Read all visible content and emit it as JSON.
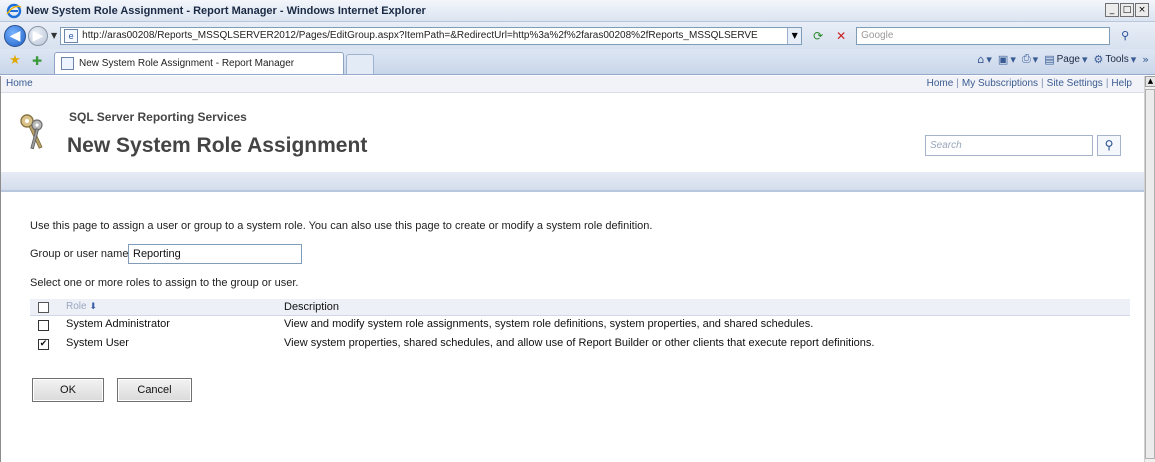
{
  "window": {
    "title": "New System Role Assignment - Report Manager - Windows Internet Explorer",
    "controls": {
      "minimize": "_",
      "maximize": "□",
      "close": "×"
    }
  },
  "addressbar": {
    "url": "http://aras00208/Reports_MSSQLSERVER2012/Pages/EditGroup.aspx?ItemPath=&RedirectUrl=http%3a%2f%2faras00208%2fReports_MSSQLSERVE",
    "search_placeholder": "Google"
  },
  "tabbar": {
    "tab_title": "New System Role Assignment - Report Manager",
    "commands": {
      "page": "Page",
      "tools": "Tools"
    }
  },
  "report_manager": {
    "breadcrumb_home": "Home",
    "top_links": [
      "Home",
      "My Subscriptions",
      "Site Settings",
      "Help"
    ],
    "product_name": "SQL Server Reporting Services",
    "page_title": "New System Role Assignment",
    "search_placeholder": "Search"
  },
  "form": {
    "intro": "Use this page to assign a user or group to a system role. You can also use this page to create or modify a system role definition.",
    "group_label": "Group or user name:",
    "group_value": "Reporting",
    "select_prompt": "Select one or more roles to assign to the group or user.",
    "table": {
      "col_role": "Role",
      "col_description": "Description",
      "rows": [
        {
          "role": "System Administrator",
          "description": "View and modify system role assignments, system role definitions, system properties, and shared schedules.",
          "checked": false
        },
        {
          "role": "System User",
          "description": "View system properties, shared schedules, and allow use of Report Builder or other clients that execute report definitions.",
          "checked": true
        }
      ]
    },
    "ok_label": "OK",
    "cancel_label": "Cancel"
  }
}
